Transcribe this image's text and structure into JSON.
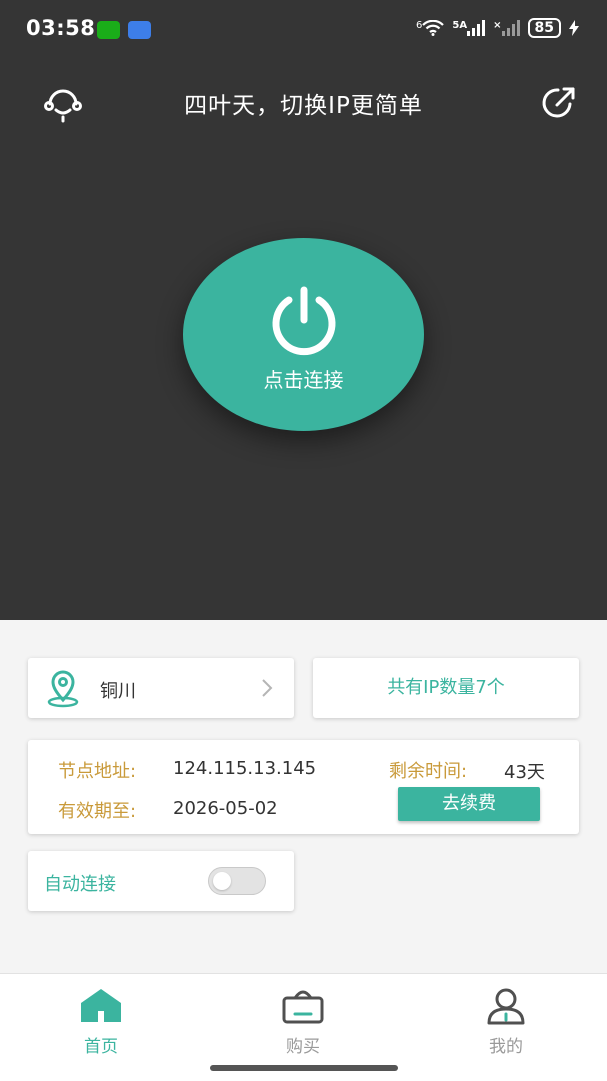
{
  "status_bar": {
    "time": "03:58",
    "wifi_label": "6",
    "signal_label": "5A",
    "battery": "85"
  },
  "header": {
    "title": "四叶天，切换IP更简单"
  },
  "connect": {
    "label": "点击连接"
  },
  "location": {
    "name": "铜川"
  },
  "ip_count": {
    "text": "共有IP数量7个"
  },
  "node": {
    "address_label": "节点地址:",
    "address": "124.115.13.145",
    "remaining_label": "剩余时间:",
    "remaining": "43天",
    "expiry_label": "有效期至:",
    "expiry": "2026-05-02",
    "renew_label": "去续费"
  },
  "auto_connect": {
    "label": "自动连接",
    "enabled": false
  },
  "tabs": [
    {
      "label": "首页",
      "active": true,
      "icon": "home-icon"
    },
    {
      "label": "购买",
      "active": false,
      "icon": "basket-icon"
    },
    {
      "label": "我的",
      "active": false,
      "icon": "user-icon"
    }
  ],
  "colors": {
    "accent": "#3bb49f",
    "dark_bg": "#353535",
    "label_gold": "#c99a3a",
    "inactive": "#9a9a9a"
  }
}
